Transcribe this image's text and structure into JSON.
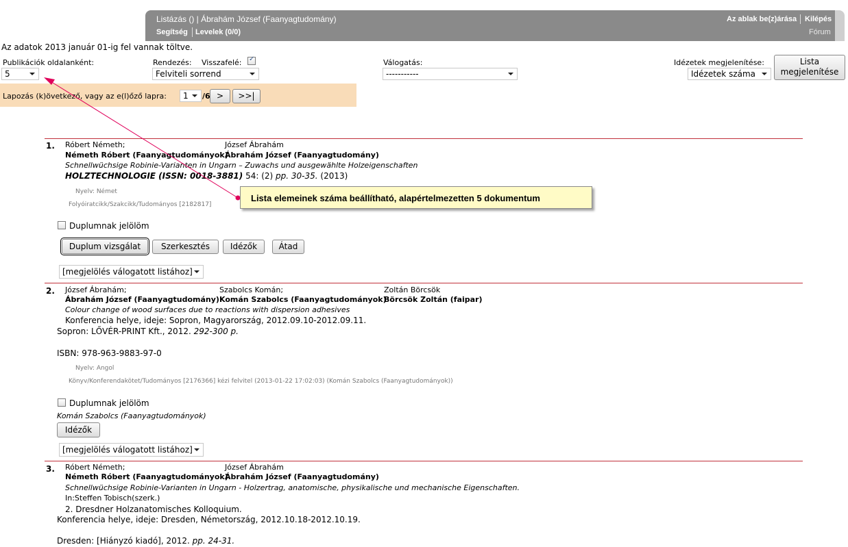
{
  "header": {
    "title": "Listázás () | Ábrahám József (Faanyagtudomány)",
    "help": "Segítség",
    "messages": "Levelek (0/0)",
    "window_settings": "Az ablak be(z)árása",
    "logout": "Kilépés",
    "forum": "Fórum"
  },
  "notice": "Az adatok 2013 január 01-ig fel vannak töltve.",
  "filters": {
    "per_page_label": "Publikációk oldalanként:",
    "per_page_value": "5",
    "sort_label": "Rendezés:",
    "sort_value": "Felviteli sorrend",
    "reverse_label": "Visszafelé:",
    "select_label": "Válogatás:",
    "select_value": "-----------",
    "citations_label": "Idézetek megjelenítése:",
    "citations_value": "Idézetek száma",
    "show_list_line1": "Lista",
    "show_list_line2": "megjelenítése"
  },
  "paging": {
    "label": "Lapozás (k)övetkező, vagy az e(l)őző lapra:",
    "page_value": "1",
    "total": "/6",
    "next": ">",
    "last": ">>|"
  },
  "tooltip": "Lista elemeinek száma beállítható, alapértelmezetten 5 dokumentum",
  "common": {
    "duplicate_mark": "Duplumnak jelölöm",
    "duplicate_check": "Duplum vizsgálat",
    "edit": "Szerkesztés",
    "citations": "Idézők",
    "transfer": "Átad",
    "mark_select": "[megjelölés válogatott listához]"
  },
  "items": [
    {
      "num": "1.",
      "author1": "Róbert Németh;",
      "author2": "József Ábrahám",
      "author1_bold": "Németh Róbert (Faanyagtudományok)",
      "author2_bold": "Ábrahám József (Faanyagtudomány)",
      "title": "Schnellwüchsige Robinie-Varianten in Ungarn – Zuwachs und ausgewählte Holzeigenschaften",
      "journal": "HOLZTECHNOLOGIE (ISSN: 0018-3881)",
      "volume": " 54: (2) ",
      "pages": "pp. 30-35.",
      "year": " (2013)",
      "language": "Nyelv: Német",
      "meta": "Folyóiratcikk/Szakcikk/Tudományos [2182817]"
    },
    {
      "num": "2.",
      "author1": "József Ábrahám;",
      "author2": "Szabolcs Komán;",
      "author3": "Zoltán Börcsök",
      "author1_bold": "Ábrahám József (Faanyagtudomány)",
      "author2_bold": "Komán Szabolcs (Faanyagtudományok)",
      "author3_bold": "Börcsök Zoltán (faipar)",
      "title": "Colour change of wood surfaces due to reactions with dispersion adhesives",
      "conference": "Konferencia helye, ideje: Sopron, Magyarország, 2012.09.10-2012.09.11.",
      "publisher": "Sopron: LŐVÉR-PRINT Kft., 2012. ",
      "pages": "292-300 p.",
      "isbn": "ISBN: 978-963-9883-97-0",
      "language": "Nyelv: Angol",
      "meta": "Könyv/Konferendakötet/Tudományos [2176366] kézi felvitel (2013-01-22 17:02:03) (Komán Szabolcs (Faanyagtudományok))",
      "owner": "Komán Szabolcs (Faanyagtudományok)"
    },
    {
      "num": "3.",
      "author1": "Róbert Németh;",
      "author2": "József Ábrahám",
      "author1_bold": "Németh Róbert (Faanyagtudományok)",
      "author2_bold": "Ábrahám József (Faanyagtudomány)",
      "title": "Schnellwüchsige Robinie-Varianten in Ungarn - Holzertrag, anatomische, physikalische und mechanische Eigenschaften.",
      "editor": "In:Steffen Tobisch(szerk.)",
      "series": "2. Dresdner Holzanatomisches Kolloquium.",
      "conference": "Konferencia helye, ideje: Dresden, Németország, 2012.10.18-2012.10.19.",
      "publisher": "Dresden: [Hiányzó kiadó], 2012. ",
      "pages": "pp. 24-31."
    }
  ]
}
